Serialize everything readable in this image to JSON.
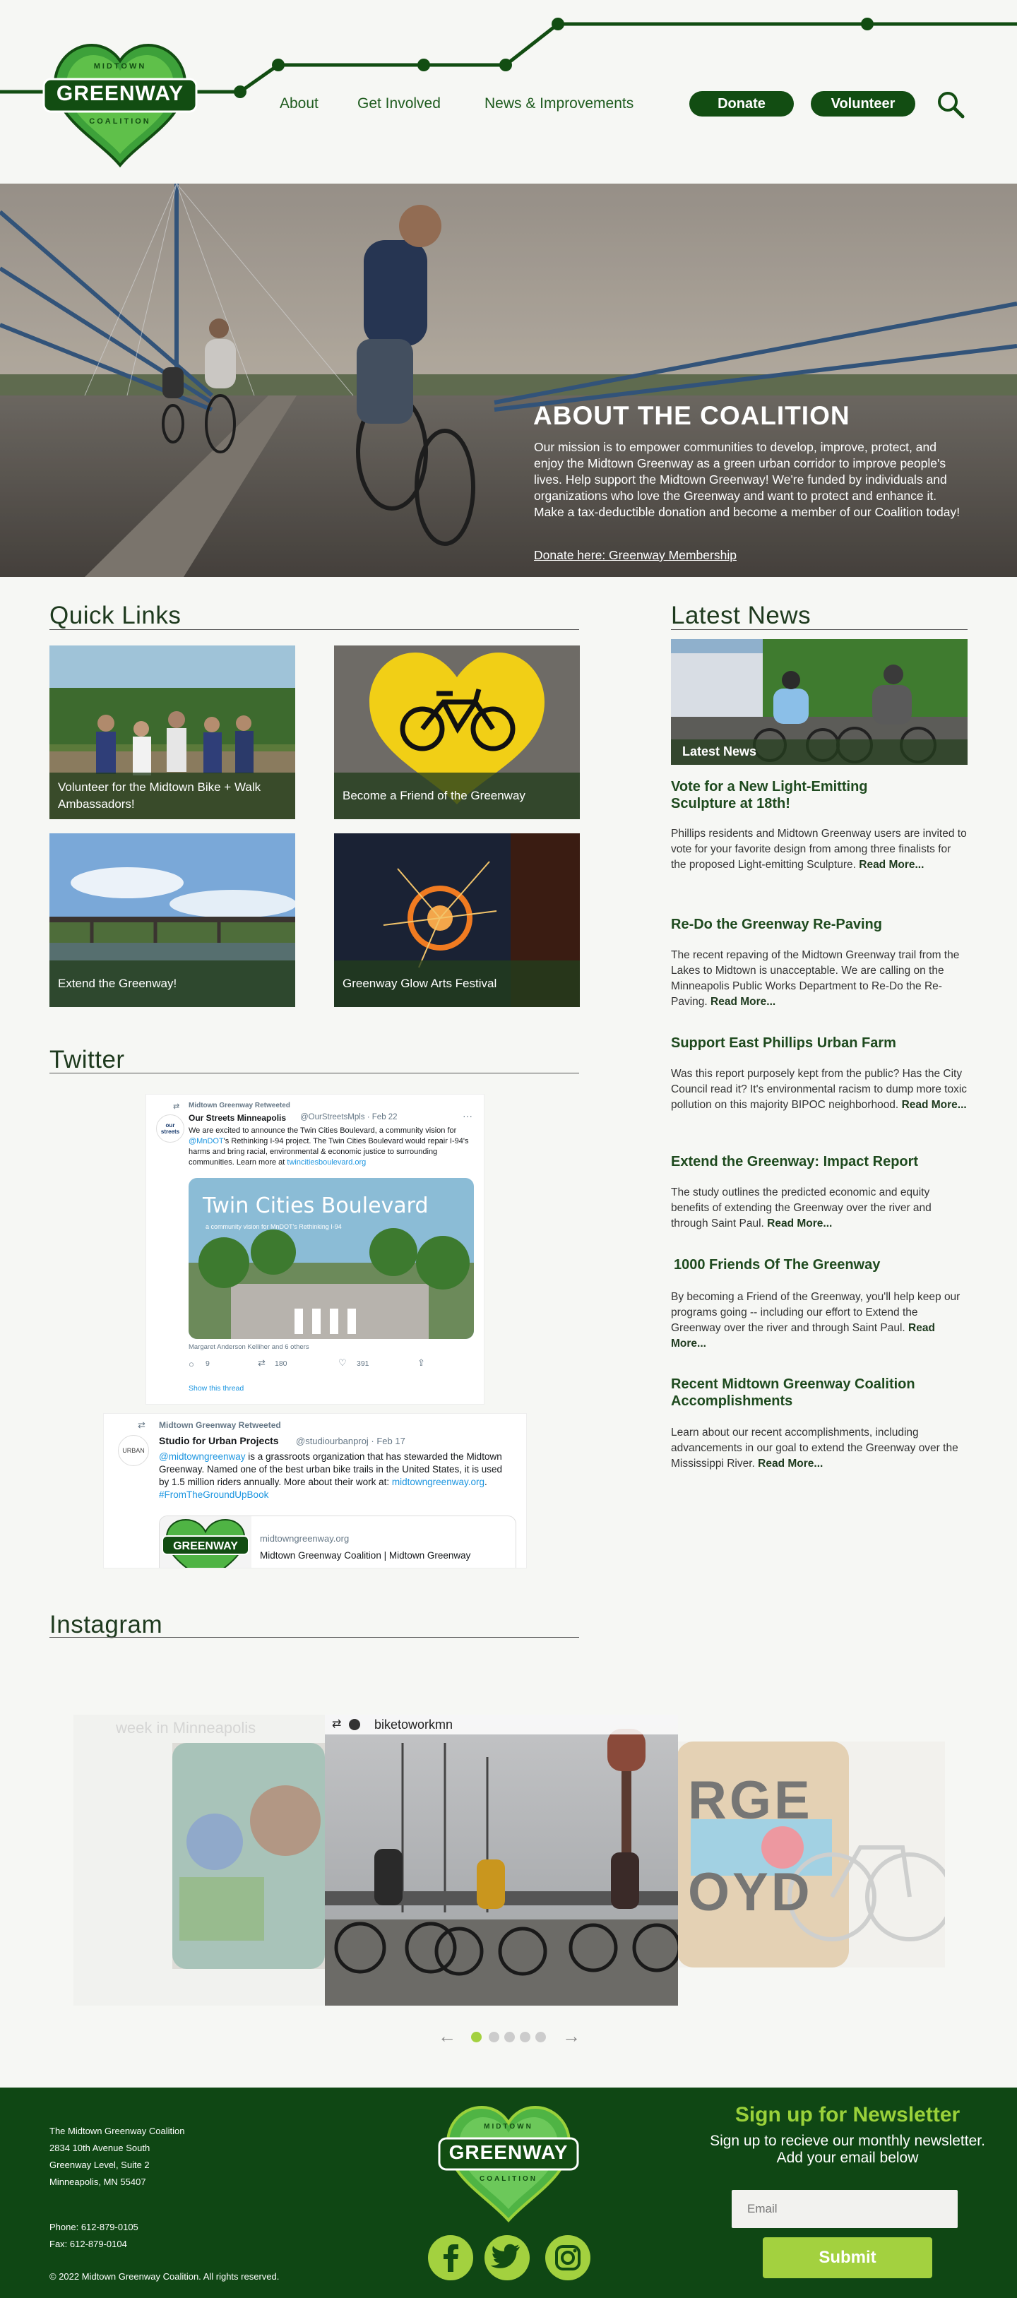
{
  "header": {
    "logo_text": "GREENWAY",
    "logo_top": "MIDTOWN",
    "logo_bottom": "COALITION",
    "nav": [
      "About",
      "Get Involved",
      "News & Improvements"
    ],
    "donate_label": "Donate",
    "volunteer_label": "Volunteer"
  },
  "hero": {
    "title": "ABOUT THE COALITION",
    "text": "Our mission is to empower communities to develop, improve, protect, and enjoy the Midtown Greenway as a green urban corridor to improve people's lives. Help support the Midtown Greenway!  We're funded by individuals and organizations who love the Greenway and want to protect and enhance it.  Make a tax-deductible donation and become a member of our Coalition today!",
    "link": "Donate here: Greenway Membership"
  },
  "quick_links": {
    "title": "Quick Links",
    "cards": [
      "Volunteer for the Midtown Bike + Walk Ambassadors!",
      "Become a Friend of the Greenway",
      "Extend the Greenway!",
      "Greenway Glow Arts Festival"
    ]
  },
  "latest_news": {
    "title": "Latest News",
    "image_caption": "Latest News",
    "items": [
      {
        "title": "Vote for a New Light-Emitting Sculpture at 18th!",
        "body": "Phillips residents and Midtown Greenway users are invited to vote for your favorite design from among three finalists for the proposed Light-emitting Sculpture.",
        "more": "Read More..."
      },
      {
        "title": "Re-Do the Greenway Re-Paving",
        "body": "The recent repaving of the Midtown Greenway trail from the Lakes to Midtown is unacceptable. We are calling on the Minneapolis Public Works Department to Re-Do the Re-Paving.",
        "more": "Read More..."
      },
      {
        "title": "Support East Phillips Urban Farm",
        "body": "Was this report purposely kept from the public? Has the City Council read it? It's environmental racism to dump more toxic pollution on this majority BIPOC neighborhood.",
        "more": "Read More..."
      },
      {
        "title": "Extend the Greenway: Impact Report",
        "body": "The study outlines the predicted economic and equity benefits of extending the Greenway over the river and through Saint Paul.",
        "more": "Read More..."
      },
      {
        "title": "1000 Friends Of The Greenway",
        "body": "By becoming a Friend of the Greenway, you'll help keep our programs going -- including our effort to Extend the Greenway over the river and through Saint Paul.",
        "more": "Read More..."
      },
      {
        "title": "Recent Midtown Greenway Coalition Accomplishments",
        "body": "Learn about our recent accomplishments, including advancements in our goal to extend the Greenway over the Mississippi River.",
        "more": "Read More..."
      }
    ]
  },
  "twitter": {
    "title": "Twitter",
    "tweet1": {
      "retweeted": "Midtown Greenway Retweeted",
      "author": "Our Streets Minneapolis",
      "handle": "@OurStreetsMpls · Feb 22",
      "avatar_text": "our streets",
      "text_a": "We are excited to announce the Twin Cities Boulevard, a community vision for ",
      "mention": "@MnDOT",
      "text_b": "'s Rethinking I-94 project. The Twin Cities Boulevard would repair I-94's harms and bring racial, environmental & economic justice to surrounding communities. Learn more at ",
      "link": "twincitiesboulevard.org",
      "image_title": "Twin Cities Boulevard",
      "image_sub": "a community vision for MnDOT's Rethinking I-94",
      "liked_by": "Margaret Anderson Kelliher and 6 others",
      "replies": "9",
      "retweets": "180",
      "likes": "391",
      "show_thread": "Show this thread"
    },
    "tweet2": {
      "retweeted": "Midtown Greenway Retweeted",
      "author": "Studio for Urban Projects",
      "handle": "@studiourbanproj · Feb 17",
      "avatar_text": "URBAN",
      "mention": "@midtowngreenway",
      "text": " is a grassroots organization that has stewarded the Midtown Greenway. Named one of the best urban bike trails in the United States, it is used by 1.5 million riders annually. More about their work at: ",
      "link": "midtowngreenway.org",
      "hashtag": "#FromTheGroundUpBook",
      "card_domain": "midtowngreenway.org",
      "card_title": "Midtown Greenway Coalition | Midtown Greenway"
    }
  },
  "instagram": {
    "title": "Instagram",
    "username": "biketoworkmn",
    "left_caption": "week in Minneapolis",
    "right_art": "RGE",
    "right_art2": "OYD",
    "dots": 5,
    "active_dot": 0
  },
  "footer": {
    "address": [
      "The Midtown Greenway Coalition",
      "2834 10th Avenue South",
      "Greenway Level, Suite 2",
      "Minneapolis, MN 55407"
    ],
    "phone": "Phone: 612-879-0105",
    "fax": "Fax: 612-879-0104",
    "copyright": "© 2022 Midtown Greenway Coalition. All rights reserved.",
    "newsletter_title": "Sign up for Newsletter",
    "newsletter_sub": "Sign up to recieve our monthly newsletter. Add your email below",
    "email_placeholder": "Email",
    "submit_label": "Submit"
  },
  "colors": {
    "dark_green": "#124d12",
    "light_green": "#a3d13f",
    "footer_green": "#0f4714"
  }
}
